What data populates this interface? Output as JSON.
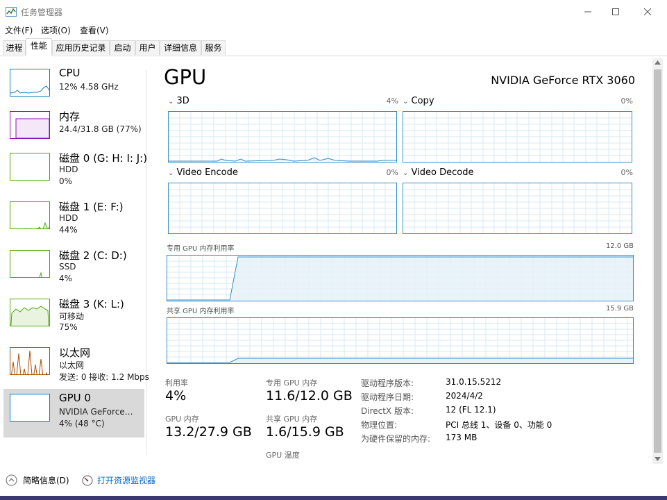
{
  "window": {
    "title": "任务管理器",
    "controls": {
      "minimize": "—",
      "maximize": "☐",
      "close": "✕"
    }
  },
  "menu": [
    "文件(F)",
    "选项(O)",
    "查看(V)"
  ],
  "tabs": [
    "进程",
    "性能",
    "应用历史记录",
    "启动",
    "用户",
    "详细信息",
    "服务"
  ],
  "active_tab": "性能",
  "sidebar": {
    "items": [
      {
        "title": "CPU",
        "lines": [
          "12%  4.58 GHz"
        ],
        "color": "#117dbb"
      },
      {
        "title": "内存",
        "lines": [
          "24.4/31.8 GB (77%)"
        ],
        "color": "#8b12ae"
      },
      {
        "title": "磁盘 0 (G: H: I: J:)",
        "lines": [
          "HDD",
          "0%"
        ],
        "color": "#4da60c"
      },
      {
        "title": "磁盘 1 (E: F:)",
        "lines": [
          "HDD",
          "44%"
        ],
        "color": "#4da60c"
      },
      {
        "title": "磁盘 2 (C: D:)",
        "lines": [
          "SSD",
          "4%"
        ],
        "color": "#4da60c"
      },
      {
        "title": "磁盘 3 (K: L:)",
        "lines": [
          "可移动",
          "75%"
        ],
        "color": "#4da60c"
      },
      {
        "title": "以太网",
        "lines": [
          "以太网",
          "发送: 0  接收: 1.2 Mbps"
        ],
        "color": "#a74f01"
      },
      {
        "title": "GPU 0",
        "lines": [
          "NVIDIA GeForce…",
          "4% (48 °C)"
        ],
        "color": "#117dbb"
      }
    ],
    "selected_index": 7
  },
  "main": {
    "title": "GPU",
    "model": "NVIDIA GeForce RTX 3060",
    "engines": [
      {
        "label": "3D",
        "pct": "4%"
      },
      {
        "label": "Copy",
        "pct": "0%"
      },
      {
        "label": "Video Encode",
        "pct": "0%"
      },
      {
        "label": "Video Decode",
        "pct": "0%"
      }
    ],
    "dedicated_label": "专用 GPU 内存利用率",
    "dedicated_max": "12.0 GB",
    "shared_label": "共享 GPU 内存利用率",
    "shared_max": "15.9 GB",
    "stats": {
      "util_label": "利用率",
      "util_value": "4%",
      "dedicated_label": "专用 GPU 内存",
      "dedicated_value": "11.6/12.0 GB",
      "gpu_mem_label": "GPU 内存",
      "gpu_mem_value": "13.2/27.9 GB",
      "shared_label": "共享 GPU 内存",
      "shared_value": "1.6/15.9 GB",
      "temp_label": "GPU 温度"
    },
    "info": [
      {
        "key": "驱动程序版本:",
        "value": "31.0.15.5212"
      },
      {
        "key": "驱动程序日期:",
        "value": "2024/4/2"
      },
      {
        "key": "DirectX 版本:",
        "value": "12 (FL 12.1)"
      },
      {
        "key": "物理位置:",
        "value": "PCI 总线 1、设备 0、功能 0"
      },
      {
        "key": "为硬件保留的内存:",
        "value": "173 MB"
      }
    ]
  },
  "footer": {
    "summary": "简略信息(D)",
    "monitor": "打开资源监视器"
  },
  "colors": {
    "accent": "#117dbb",
    "graph_border": "#2f8ec6",
    "link": "#0066cc",
    "selected": "#d9d9d9"
  }
}
